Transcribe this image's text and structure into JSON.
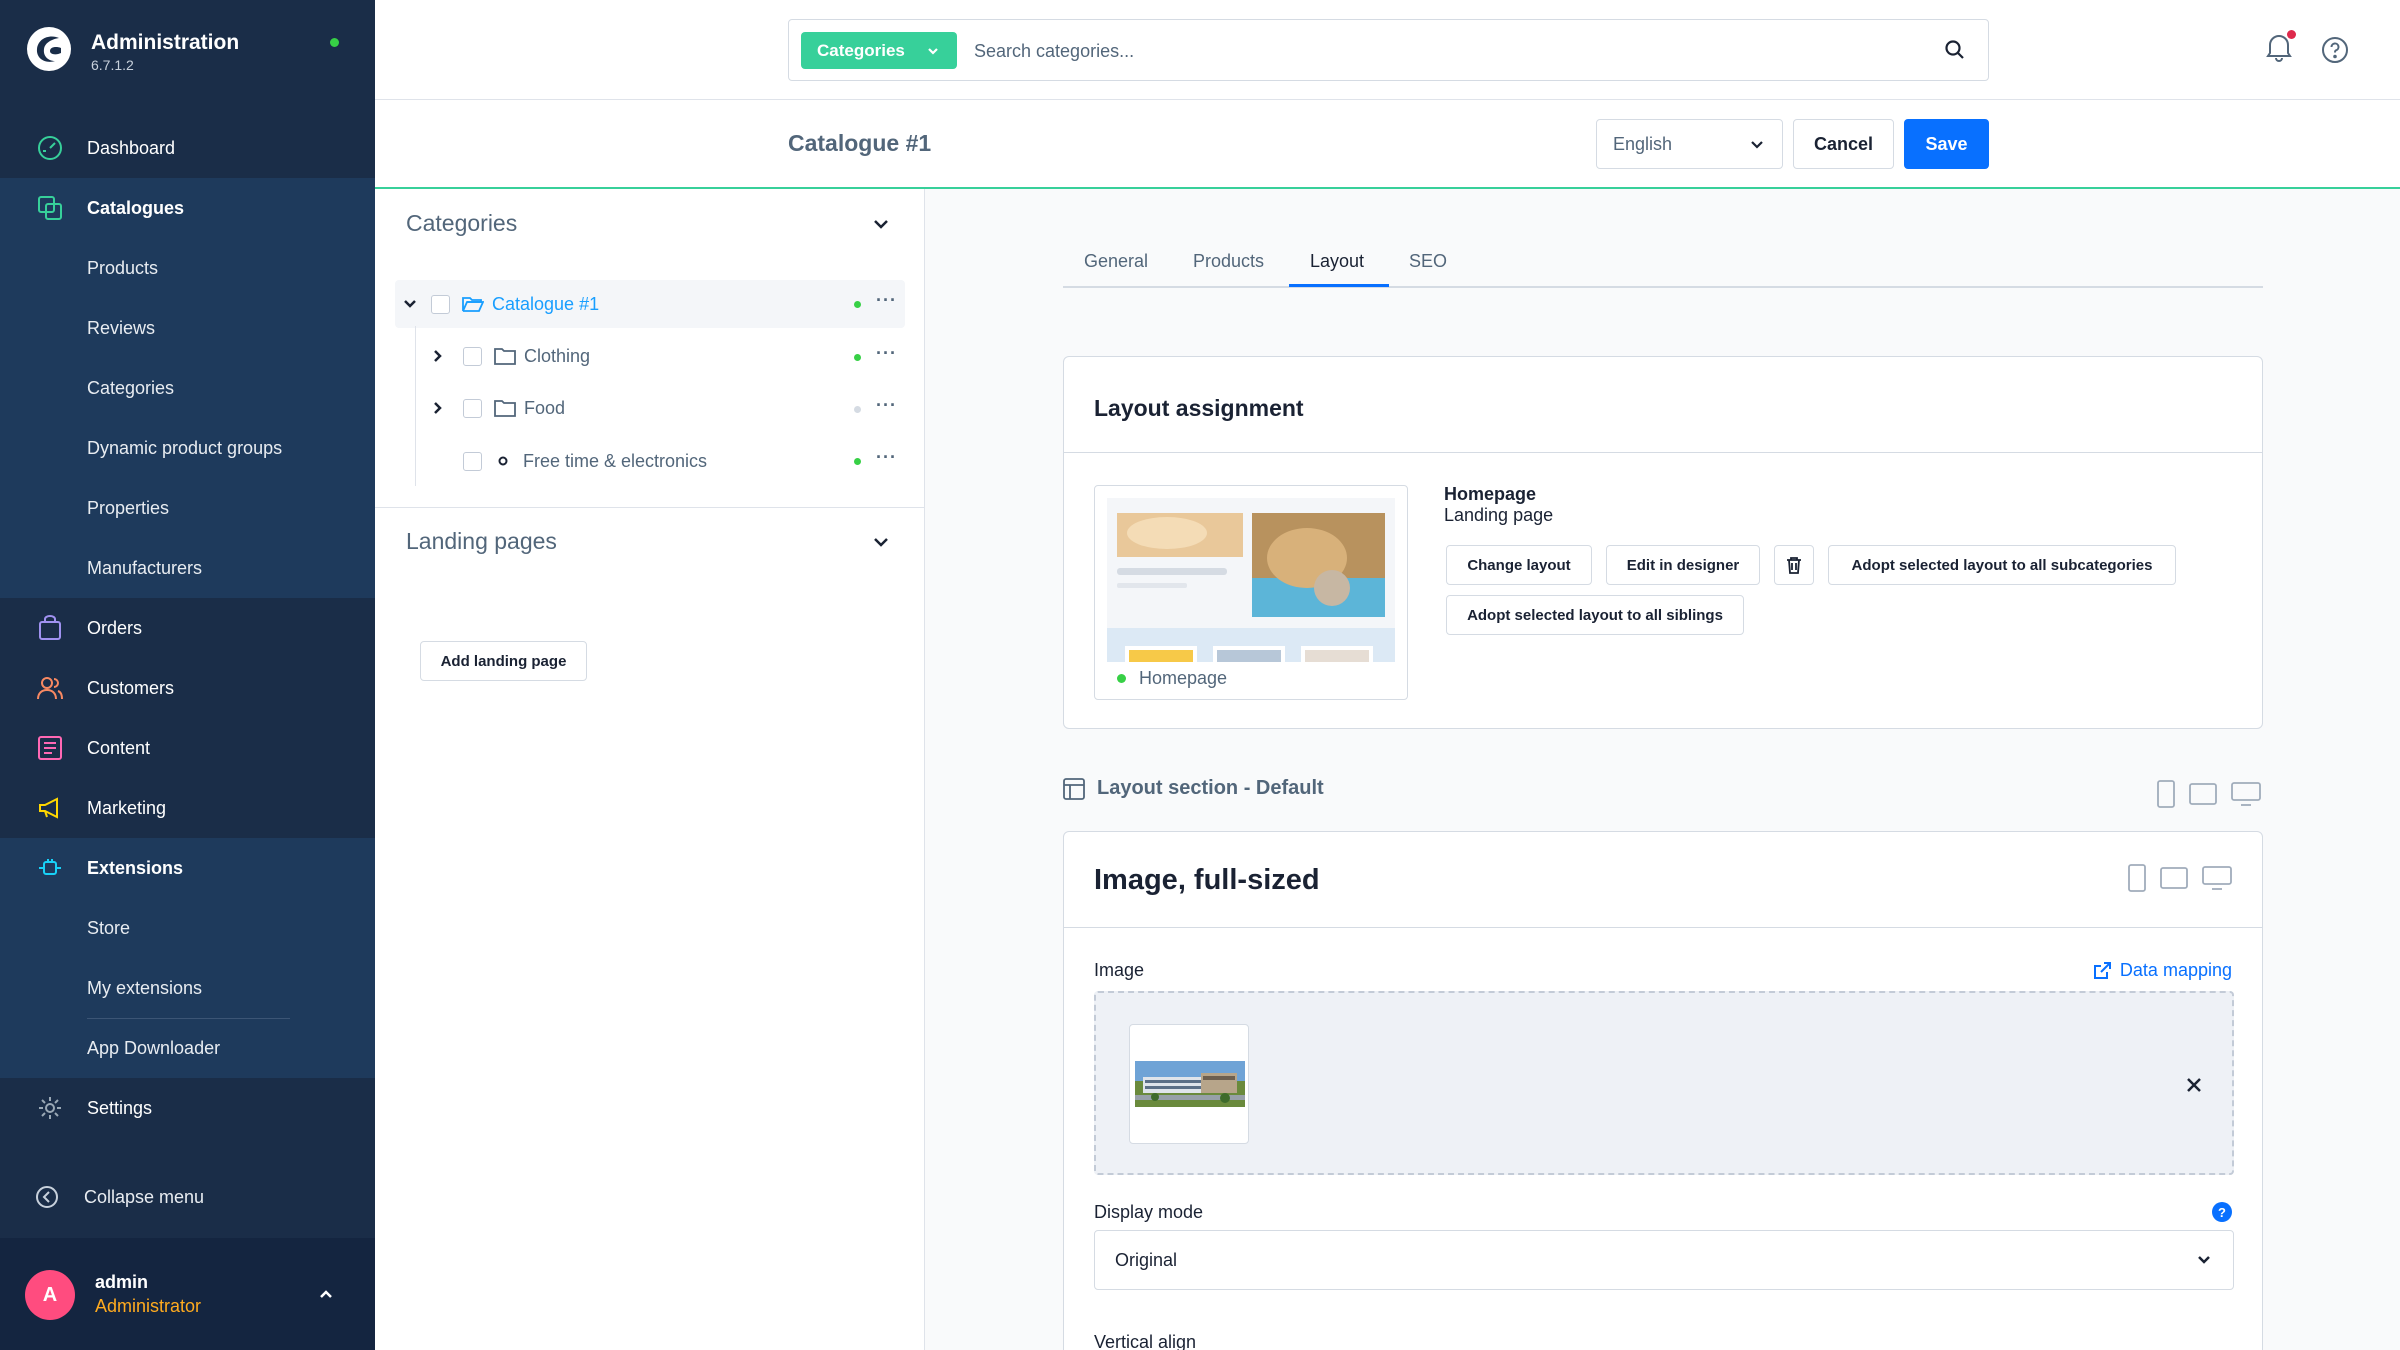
{
  "brand": {
    "title": "Administration",
    "version": "6.7.1.2"
  },
  "nav": {
    "dashboard": "Dashboard",
    "catalogues": "Catalogues",
    "catalogue_items": [
      "Products",
      "Reviews",
      "Categories",
      "Dynamic product groups",
      "Properties",
      "Manufacturers"
    ],
    "orders": "Orders",
    "customers": "Customers",
    "content": "Content",
    "marketing": "Marketing",
    "extensions": "Extensions",
    "extension_items": [
      "Store",
      "My extensions",
      "App Downloader"
    ],
    "settings": "Settings",
    "collapse": "Collapse menu"
  },
  "user": {
    "initial": "A",
    "name": "admin",
    "role": "Administrator"
  },
  "search": {
    "type_label": "Categories",
    "placeholder": "Search categories..."
  },
  "header": {
    "title": "Catalogue #1",
    "language": "English",
    "cancel": "Cancel",
    "save": "Save"
  },
  "tree": {
    "heading": "Categories",
    "items": [
      "Catalogue #1",
      "Clothing",
      "Food",
      "Free time & electronics"
    ],
    "landing_heading": "Landing pages",
    "add_landing": "Add landing page"
  },
  "tabs": [
    "General",
    "Products",
    "Layout",
    "SEO"
  ],
  "layout_assignment": {
    "title": "Layout assignment",
    "preview_label": "Homepage",
    "layout_name": "Homepage",
    "layout_type": "Landing page",
    "change": "Change layout",
    "edit": "Edit in designer",
    "adopt_sub": "Adopt selected layout to all subcategories",
    "adopt_sib": "Adopt selected layout to all siblings"
  },
  "section": {
    "title": "Layout section - Default"
  },
  "element": {
    "title": "Image, full-sized",
    "image_label": "Image",
    "data_mapping": "Data mapping",
    "display_mode_label": "Display mode",
    "display_mode_value": "Original",
    "vertical_align_label": "Vertical align"
  },
  "colors": {
    "sidebar": "#1a2d48",
    "accent": "#37d09a",
    "primary": "#0870ff",
    "status_active": "#37d046"
  }
}
